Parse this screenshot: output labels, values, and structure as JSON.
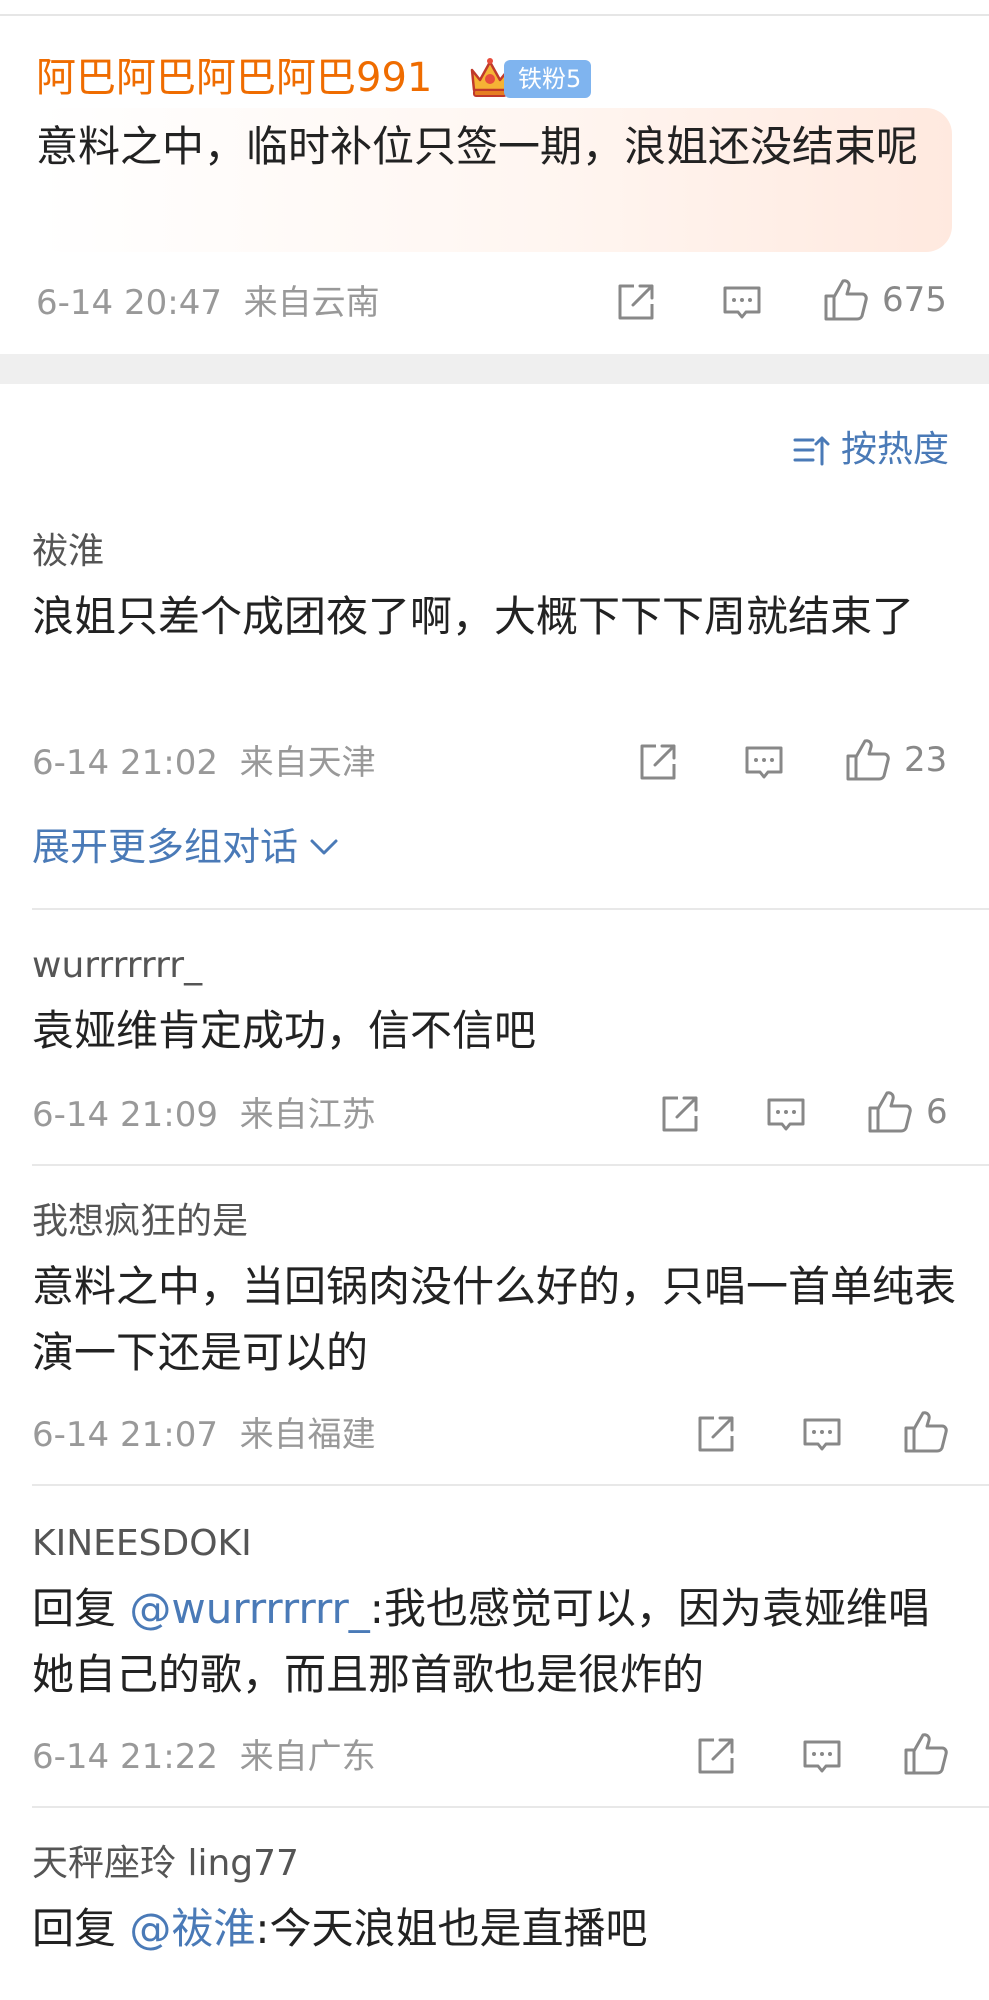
{
  "pinned_comment": {
    "username": "阿巴阿巴阿巴阿巴991",
    "fan_badge": "铁粉5",
    "text": "意料之中，临时补位只签一期，浪姐还没结束呢",
    "date": "6-14 20:47",
    "location": "来自云南",
    "likes": "675"
  },
  "sort": {
    "label": "按热度",
    "icon": "sort-icon"
  },
  "comments": [
    {
      "username": "祓淮",
      "text": "浪姐只差个成团夜了啊，大概下下下周就结束了",
      "date": "6-14 21:02",
      "location": "来自天津",
      "likes": "23"
    },
    {
      "username": "wurrrrrrr_",
      "text": "袁娅维肯定成功，信不信吧",
      "date": "6-14 21:09",
      "location": "来自江苏",
      "likes": "6"
    },
    {
      "username": "我想疯狂的是",
      "text": "意料之中，当回锅肉没什么好的，只唱一首单纯表演一下还是可以的",
      "date": "6-14 21:07",
      "location": "来自福建",
      "likes": ""
    },
    {
      "username": "KINEESDOKI",
      "reply_prefix": "回复 ",
      "mention": "@wurrrrrrr_",
      "text": ":我也感觉可以，因为袁娅维唱她自己的歌，而且那首歌也是很炸的",
      "date": "6-14 21:22",
      "location": "来自广东",
      "likes": ""
    },
    {
      "username": "天秤座玲 ling77",
      "reply_prefix": "回复 ",
      "mention": "@祓淮",
      "text": ":今天浪姐也是直播吧"
    }
  ],
  "expand_link": {
    "label": "展开更多组对话"
  },
  "colors": {
    "accent": "#4a7ab7",
    "username_highlight": "#ef6c00",
    "badge": "#7fb4ef",
    "meta": "#999999"
  }
}
